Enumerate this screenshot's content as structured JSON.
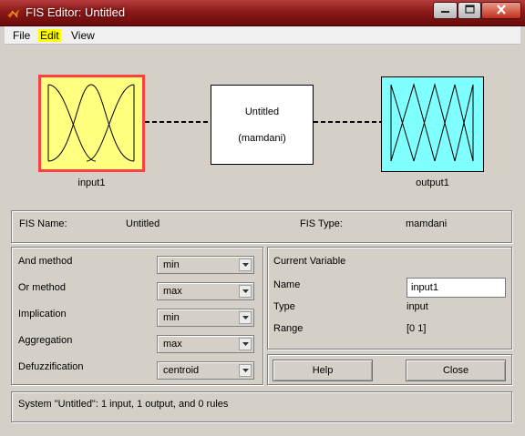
{
  "window": {
    "title": "FIS Editor: Untitled"
  },
  "menu": {
    "file": "File",
    "edit": "Edit",
    "view": "View"
  },
  "diagram": {
    "input_label": "input1",
    "output_label": "output1",
    "system_name": "Untitled",
    "system_type": "(mamdani)",
    "colors": {
      "input_box": "#ffff80",
      "output_box": "#80ffff",
      "selected_border": "#ff4040"
    }
  },
  "fis_info": {
    "name_label": "FIS Name:",
    "name_value": "Untitled",
    "type_label": "FIS Type:",
    "type_value": "mamdani"
  },
  "methods": [
    {
      "label": "And method",
      "value": "min"
    },
    {
      "label": "Or method",
      "value": "max"
    },
    {
      "label": "Implication",
      "value": "min"
    },
    {
      "label": "Aggregation",
      "value": "max"
    },
    {
      "label": "Defuzzification",
      "value": "centroid"
    }
  ],
  "current_variable": {
    "header": "Current Variable",
    "name_label": "Name",
    "name_value": "input1",
    "type_label": "Type",
    "type_value": "input",
    "range_label": "Range",
    "range_value": "[0 1]"
  },
  "buttons": {
    "help": "Help",
    "close": "Close"
  },
  "status": "System \"Untitled\": 1 input, 1 output, and 0 rules"
}
